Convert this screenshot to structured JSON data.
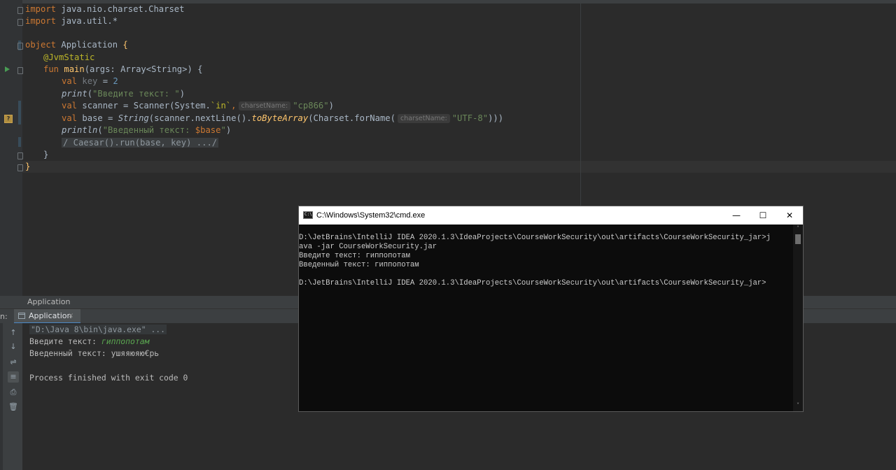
{
  "editor": {
    "lines": {
      "l1": {
        "kw": "import",
        "text": " java.nio.charset.Charset"
      },
      "l2": {
        "kw": "import",
        "text": " java.util.*"
      },
      "l4": {
        "kw": "object",
        "name": " Application ",
        "brace": "{"
      },
      "l5": {
        "annotation": "@JvmStatic"
      },
      "l6": {
        "kw": "fun",
        "fn": "main",
        "text": "(args: Array<String>) {"
      },
      "l7": {
        "kw": "val",
        "name": " key",
        "eq": " = ",
        "num": "2"
      },
      "l8": {
        "fn": "print",
        "open": "(",
        "str": "\"Введите текст: \"",
        "close": ")"
      },
      "l9": {
        "kw": "val",
        "text": " scanner = Scanner(System.",
        "field": "`in`",
        "comma": ",",
        "hint": "charsetName:",
        "str": "\"cp866\"",
        "close": ")"
      },
      "l10": {
        "kw": "val",
        "text": " base = ",
        "ital": "String",
        "text2": "(scanner.nextLine().",
        "ext": "toByteArray",
        "text3": "(Charset.forName(",
        "hint": "charsetName:",
        "str": "\"UTF-8\"",
        "close": ")))"
      },
      "l11": {
        "fn": "println",
        "open": "(",
        "str": "\"Введенный текст: ",
        "tmpl": "$base",
        "strclose": "\"",
        "close": ")"
      },
      "l12": {
        "folded": "/ Caesar().run(base, key) .../"
      },
      "l13": {
        "brace": "}"
      },
      "l14": {
        "brace": "}"
      }
    }
  },
  "tool_window": {
    "title": "Application",
    "run_label": "n:",
    "tab_label": "Application",
    "tab_close": "×",
    "side_buttons": [
      "↑",
      "↓",
      "⇌",
      "≡",
      "⎙",
      "🗑"
    ],
    "console": {
      "cmd": "\"D:\\Java 8\\bin\\java.exe\" ...",
      "prompt": "Введите текст: ",
      "input": "гиппопотам",
      "output": "Введенный текст: ушяяюяю€рь",
      "finished": "Process finished with exit code 0"
    }
  },
  "cmd_window": {
    "title": "C:\\Windows\\System32\\cmd.exe",
    "icon_text": "C:\\",
    "controls": {
      "minimize": "—",
      "maximize": "☐",
      "close": "✕"
    },
    "lines": [
      "D:\\JetBrains\\IntelliJ IDEA 2020.1.3\\IdeaProjects\\CourseWorkSecurity\\out\\artifacts\\CourseWorkSecurity_jar>j",
      "ava -jar CourseWorkSecurity.jar",
      "Введите текст: гиппопотам",
      "Введенный текст: гиппопотам",
      "",
      "D:\\JetBrains\\IntelliJ IDEA 2020.1.3\\IdeaProjects\\CourseWorkSecurity\\out\\artifacts\\CourseWorkSecurity_jar>"
    ],
    "scroll_up": "˄",
    "scroll_down": "˅"
  }
}
